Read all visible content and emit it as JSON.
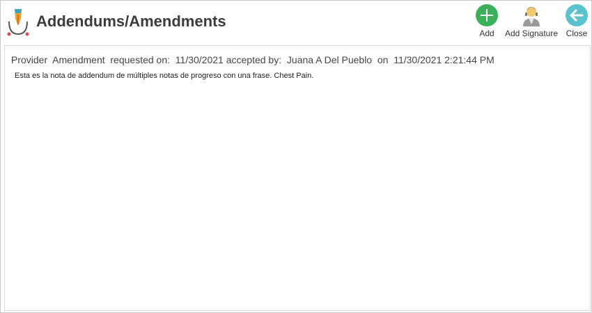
{
  "window": {
    "title": "Addendums/Amendments"
  },
  "toolbar": {
    "add_label": "Add",
    "add_signature_label": "Add Signature",
    "close_label": "Close"
  },
  "addendum": {
    "meta": "Provider  Amendment  requested on:  11/30/2021 accepted by:  Juana A Del Pueblo  on  11/30/2021 2:21:44 PM",
    "note": "Esta es la nota de addendum de múltiples notas de progreso con una frase. Chest Pain."
  },
  "colors": {
    "add_green": "#3bb05a",
    "close_teal": "#5bc3cf",
    "title_text": "#3c3c3c"
  },
  "icons": {
    "app": "quill-pen-icon",
    "add": "plus-circle-icon",
    "signature": "user-signature-icon",
    "close": "back-arrow-circle-icon"
  }
}
